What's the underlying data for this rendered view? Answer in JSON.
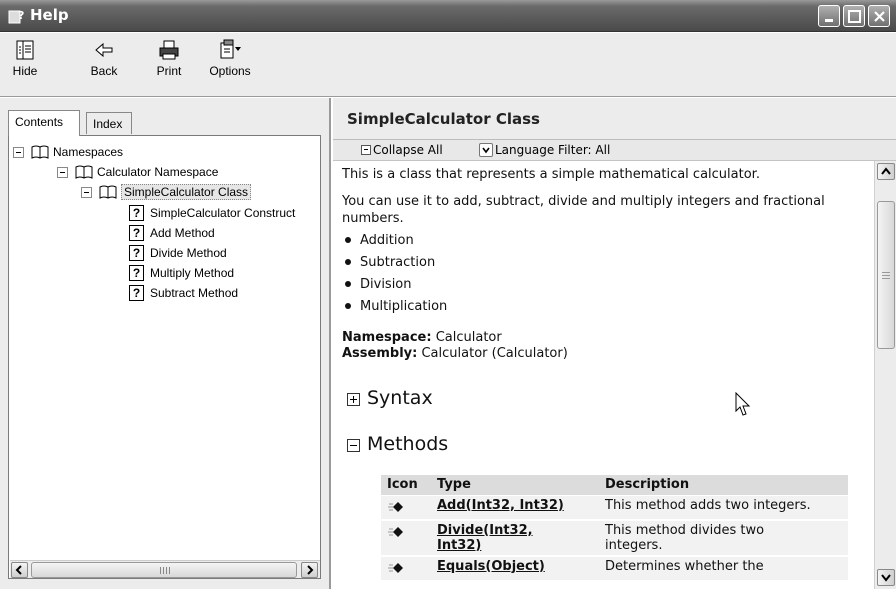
{
  "window": {
    "title": "Help",
    "icon": "help-window-icon",
    "controls": [
      "minimize-icon",
      "maximize-icon",
      "close-icon"
    ]
  },
  "toolbar": {
    "hide_label": "Hide",
    "back_label": "Back",
    "print_label": "Print",
    "options_label": "Options"
  },
  "left_pane": {
    "tabs": {
      "contents": "Contents",
      "index": "Index"
    },
    "tree": [
      {
        "label": "Namespaces",
        "type": "book",
        "expanded": true
      },
      {
        "label": "Calculator Namespace",
        "type": "book",
        "expanded": true
      },
      {
        "label": "SimpleCalculator Class",
        "type": "book",
        "expanded": true,
        "selected": true
      },
      {
        "label": "SimpleCalculator Construct",
        "type": "page"
      },
      {
        "label": "Add Method",
        "type": "page"
      },
      {
        "label": "Divide Method",
        "type": "page"
      },
      {
        "label": "Multiply Method",
        "type": "page"
      },
      {
        "label": "Subtract Method",
        "type": "page"
      }
    ]
  },
  "right_pane": {
    "title": "SimpleCalculator Class",
    "collapse_label": "Collapse All",
    "language_filter": "Language Filter: All",
    "intro": "This is a class that represents a simple mathematical calculator.",
    "description": "You can use it to add, subtract, divide and multiply integers and fractional numbers.",
    "bullets": [
      "Addition",
      "Subtraction",
      "Division",
      "Multiplication"
    ],
    "namespace_label": "Namespace:",
    "namespace_value": "Calculator",
    "assembly_label": "Assembly:",
    "assembly_value": "Calculator (Calculator)",
    "sections": {
      "syntax": "Syntax",
      "methods": "Methods"
    },
    "methods_table": {
      "headers": [
        "Icon",
        "Type",
        "Description"
      ],
      "rows": [
        {
          "type": "Add(Int32, Int32)",
          "description": "This method adds two integers."
        },
        {
          "type_line1": "Divide(Int32,",
          "type_line2": "Int32)",
          "desc_line1": "This method divides two",
          "desc_line2": "integers."
        },
        {
          "type": "Equals(Object)",
          "description": "Determines whether the"
        }
      ]
    }
  },
  "colors": {
    "titlebar": "#5a5a5a",
    "chrome": "#ececec",
    "header_band": "#dcdcdc"
  }
}
